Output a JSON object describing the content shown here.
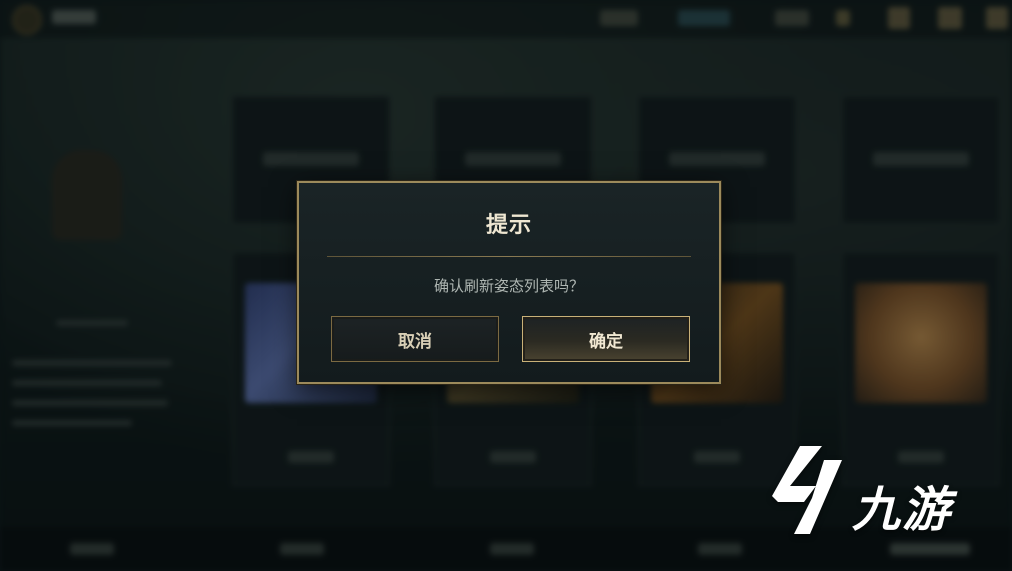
{
  "dialog": {
    "title": "提示",
    "message": "确认刷新姿态列表吗？",
    "cancel_label": "取消",
    "confirm_label": "确定"
  },
  "watermark": {
    "text": "九游",
    "icon": "jiuyou-logo-icon"
  },
  "colors": {
    "dialog_border": "#9c8a5b",
    "dialog_bg": "#16202 2",
    "title_text": "#efe7d2",
    "button_confirm_border": "#c9b178",
    "button_cancel_border": "#7c6a42"
  }
}
